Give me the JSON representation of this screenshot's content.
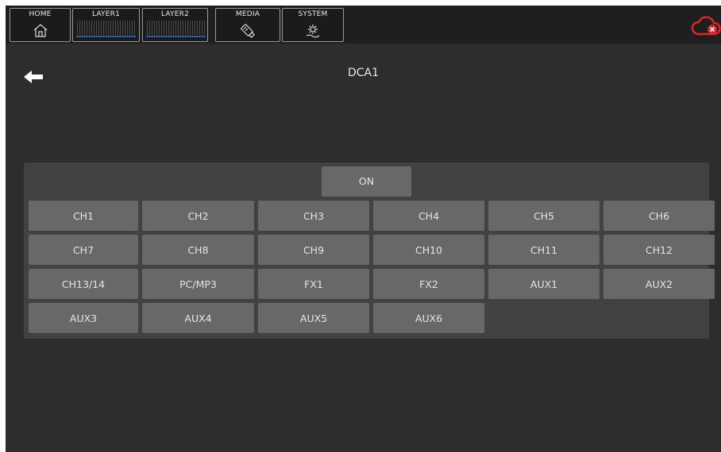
{
  "tabs": [
    {
      "label": "HOME",
      "icon": "home-icon"
    },
    {
      "label": "LAYER1",
      "icon": "meter-bars-icon"
    },
    {
      "label": "LAYER2",
      "icon": "meter-bars-icon"
    },
    {
      "label": "MEDIA",
      "icon": "usb-drive-icon"
    },
    {
      "label": "SYSTEM",
      "icon": "gear-hand-icon"
    }
  ],
  "status": {
    "icon": "cloud-disconnected-icon",
    "color": "#e0252b"
  },
  "page": {
    "title": "DCA1",
    "back_icon": "back-arrow-icon"
  },
  "on_button": {
    "label": "ON"
  },
  "channels": [
    "CH1",
    "CH2",
    "CH3",
    "CH4",
    "CH5",
    "CH6",
    "CH7",
    "CH8",
    "CH9",
    "CH10",
    "CH11",
    "CH12",
    "CH13/14",
    "PC/MP3",
    "FX1",
    "FX2",
    "AUX1",
    "AUX2",
    "AUX3",
    "AUX4",
    "AUX5",
    "AUX6"
  ],
  "colors": {
    "background": "#2d2d2d",
    "panel": "#424242",
    "button": "#686868",
    "meter_dot": "#3d7bd9"
  }
}
